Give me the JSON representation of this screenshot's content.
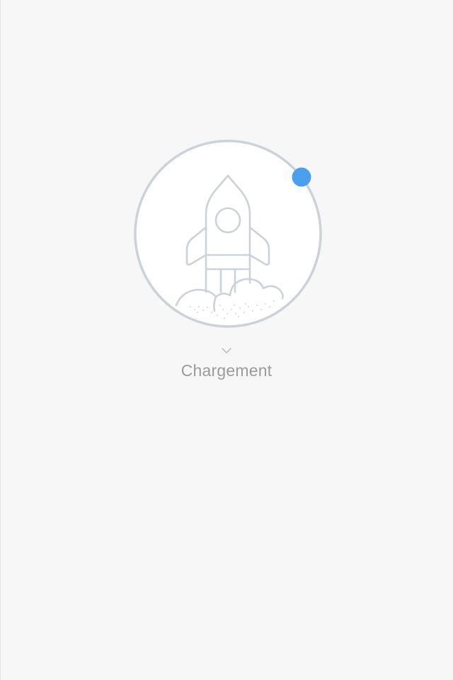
{
  "loading": {
    "label": "Chargement",
    "icon": "rocket-icon",
    "indicator_icon": "chevron-down-icon",
    "spinner_color": "#4a9ff0",
    "ring_color": "#cdd2d8"
  }
}
